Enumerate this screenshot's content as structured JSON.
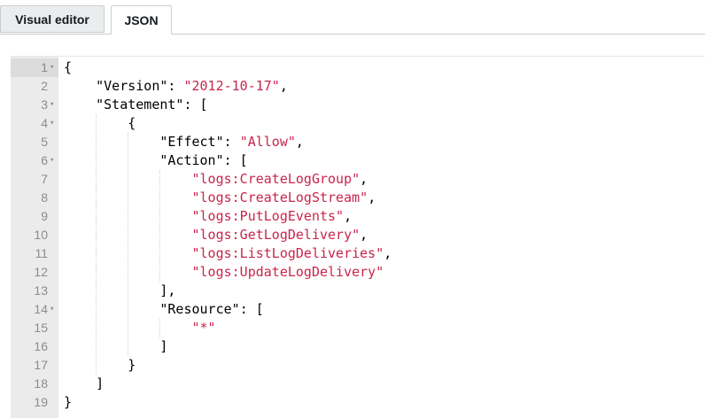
{
  "tabs": {
    "visual_editor": "Visual editor",
    "json": "JSON"
  },
  "editor": {
    "lines": [
      {
        "n": "1",
        "fold": true,
        "text": "{"
      },
      {
        "n": "2",
        "fold": false,
        "text": "    \"Version\": \"2012-10-17\","
      },
      {
        "n": "3",
        "fold": true,
        "text": "    \"Statement\": ["
      },
      {
        "n": "4",
        "fold": true,
        "text": "        {"
      },
      {
        "n": "5",
        "fold": false,
        "text": "            \"Effect\": \"Allow\","
      },
      {
        "n": "6",
        "fold": true,
        "text": "            \"Action\": ["
      },
      {
        "n": "7",
        "fold": false,
        "text": "                \"logs:CreateLogGroup\","
      },
      {
        "n": "8",
        "fold": false,
        "text": "                \"logs:CreateLogStream\","
      },
      {
        "n": "9",
        "fold": false,
        "text": "                \"logs:PutLogEvents\","
      },
      {
        "n": "10",
        "fold": false,
        "text": "                \"logs:GetLogDelivery\","
      },
      {
        "n": "11",
        "fold": false,
        "text": "                \"logs:ListLogDeliveries\","
      },
      {
        "n": "12",
        "fold": false,
        "text": "                \"logs:UpdateLogDelivery\""
      },
      {
        "n": "13",
        "fold": false,
        "text": "            ],"
      },
      {
        "n": "14",
        "fold": true,
        "text": "            \"Resource\": ["
      },
      {
        "n": "15",
        "fold": false,
        "text": "                \"*\""
      },
      {
        "n": "16",
        "fold": false,
        "text": "            ]"
      },
      {
        "n": "17",
        "fold": false,
        "text": "        }"
      },
      {
        "n": "18",
        "fold": false,
        "text": "    ]"
      },
      {
        "n": "19",
        "fold": false,
        "text": "}"
      }
    ],
    "fold_icon": "fold-arrow-icon",
    "colors": {
      "string": "#c7254e",
      "gutter": "#ebebeb",
      "line_number": "#8c8c8c"
    }
  }
}
